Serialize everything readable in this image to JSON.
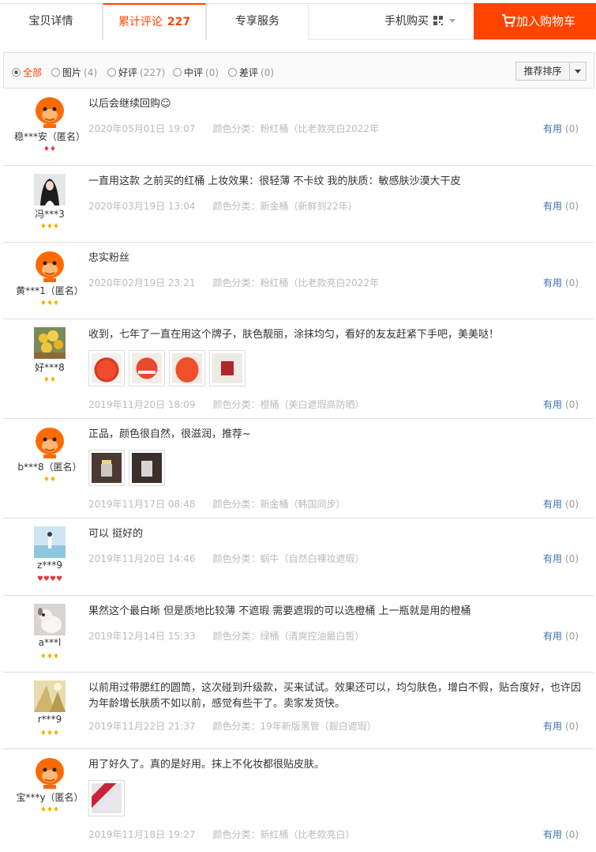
{
  "tabs": [
    {
      "label": "宝贝详情"
    },
    {
      "label": "累计评论",
      "count": "227"
    },
    {
      "label": "专享服务"
    }
  ],
  "buy_mobile": {
    "label": "手机购买"
  },
  "cart": {
    "label": "加入购物车"
  },
  "filters": [
    {
      "label": "全部",
      "count": "",
      "checked": true
    },
    {
      "label": "图片",
      "count": "(4)"
    },
    {
      "label": "好评",
      "count": "(227)"
    },
    {
      "label": "中评",
      "count": "(0)"
    },
    {
      "label": "差评",
      "count": "(0)"
    }
  ],
  "sort": {
    "label": "推荐排序"
  },
  "useful_label": "有用",
  "reviews": [
    {
      "user": "稳***安（匿名）",
      "rank": "♦♦",
      "text": "以后会继续回购☺",
      "date": "2020年05月01日 19:07",
      "sku": "颜色分类：粉红桶（比老款亮白2022年",
      "useful": "(0)"
    },
    {
      "user": "冯***3",
      "rank": "♦♦♦",
      "text": "一直用这款 之前买的红桶 上妆效果：很轻薄 不卡纹 我的肤质：敏感肤沙漠大干皮",
      "date": "2020年03月19日 13:04",
      "sku": "颜色分类：新金桶（新鲜到22年）",
      "useful": "(0)"
    },
    {
      "user": "黄***1（匿名）",
      "rank": "♦♦♦",
      "text": "忠实粉丝",
      "date": "2020年02月19日 23:21",
      "sku": "颜色分类：粉红桶（比老款亮白2022年",
      "useful": "(0)"
    },
    {
      "user": "好***8",
      "rank": "♦♦",
      "text": "收到，七年了一直在用这个牌子，肤色靓丽，涂抹均匀，看好的友友赶紧下手吧，美美哒！",
      "date": "2019年11月20日 18:09",
      "sku": "颜色分类：橙桶（美白遮瑕高防晒）",
      "useful": "(0)"
    },
    {
      "user": "b***8（匿名）",
      "rank": "♦♦",
      "text": "正品，颜色很自然，很滋润，推荐~",
      "date": "2019年11月17日 08:48",
      "sku": "颜色分类：新金桶（韩国同步）",
      "useful": "(0)"
    },
    {
      "user": "z***9",
      "rank": "♥♥♥♥",
      "text": "可以 挺好的",
      "date": "2019年11月20日 14:46",
      "sku": "颜色分类：蜗牛（自然白裸妆遮瑕）",
      "useful": "(0)"
    },
    {
      "user": "a***l",
      "rank": "♦♦♦",
      "text": "果然这个最白晰 但是质地比较薄 不遮瑕 需要遮瑕的可以选橙桶 上一瓶就是用的橙桶",
      "date": "2019年12月14日 15:33",
      "sku": "颜色分类：绿桶（清爽控油最白皙）",
      "useful": "(0)"
    },
    {
      "user": "r***9",
      "rank": "♦♦♦",
      "text": "以前用过带腮红的圆筒，这次碰到升级款，买来试试。效果还可以，均匀肤色，增白不假，贴合度好，也许因为年龄增长肤质不如以前，感觉有些干了。卖家发货快。",
      "date": "2019年11月22日 21:37",
      "sku": "颜色分类：19年新版黑管（靓白遮瑕）",
      "useful": "(0)"
    },
    {
      "user": "宝***y（匿名）",
      "rank": "♦♦♦",
      "text": "用了好久了。真的是好用。抹上不化妆都很贴皮肤。",
      "date": "2019年11月18日 19:27",
      "sku": "颜色分类：新红桶（比老款亮白）",
      "useful": "(0)"
    }
  ]
}
